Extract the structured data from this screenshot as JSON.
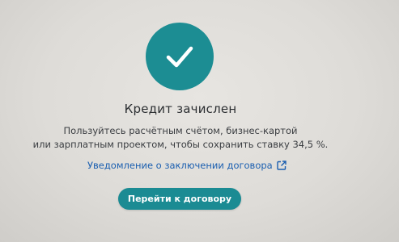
{
  "status": {
    "icon": "checkmark-icon",
    "title": "Кредит зачислен",
    "description_line1": "Пользуйтесь расчётным счётом, бизнес-картой",
    "description_line2": "или зарплатным проектом, чтобы сохранить ставку 34,5 %."
  },
  "link": {
    "label": "Уведомление о заключении договора",
    "icon": "external-link-icon"
  },
  "primary_button": {
    "label": "Перейти к договору"
  },
  "colors": {
    "accent": "#1c8d93",
    "link": "#1b5fb0",
    "background": "#dcdad6"
  }
}
